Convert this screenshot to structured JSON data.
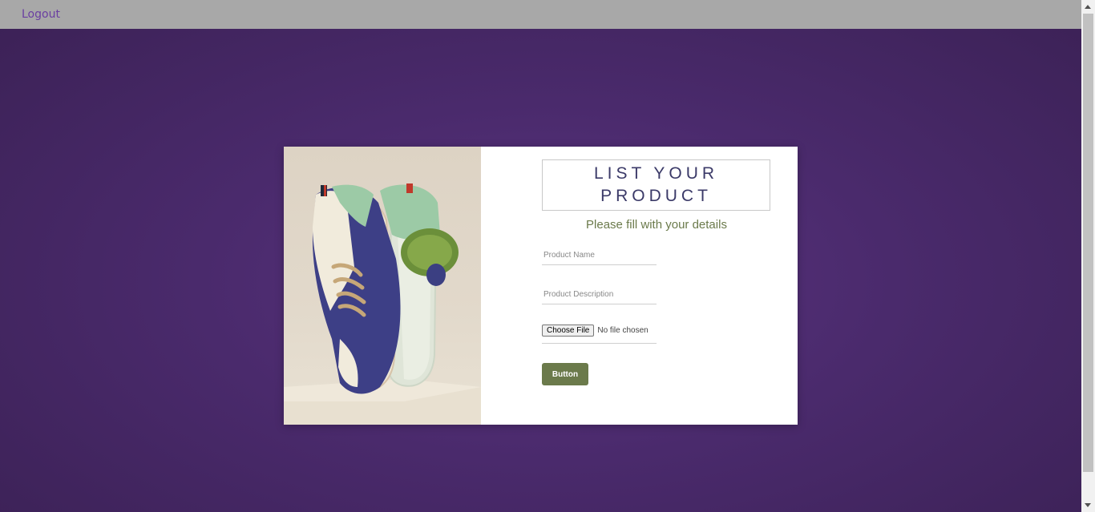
{
  "nav": {
    "logout_label": "Logout"
  },
  "form": {
    "title": "LIST YOUR PRODUCT",
    "subtitle": "Please fill with your details",
    "product_name_placeholder": "Product Name",
    "product_description_placeholder": "Product Description",
    "file_button_label": "Choose File",
    "file_status": "No file chosen",
    "submit_label": "Button"
  },
  "colors": {
    "background": "#4a2a6c",
    "accent_green": "#6b7a4b",
    "title_color": "#3b3a68",
    "topbar": "#a8a8a8",
    "link": "#6a3ea1"
  },
  "image": {
    "subject": "sneaker-with-cactus-photo"
  }
}
